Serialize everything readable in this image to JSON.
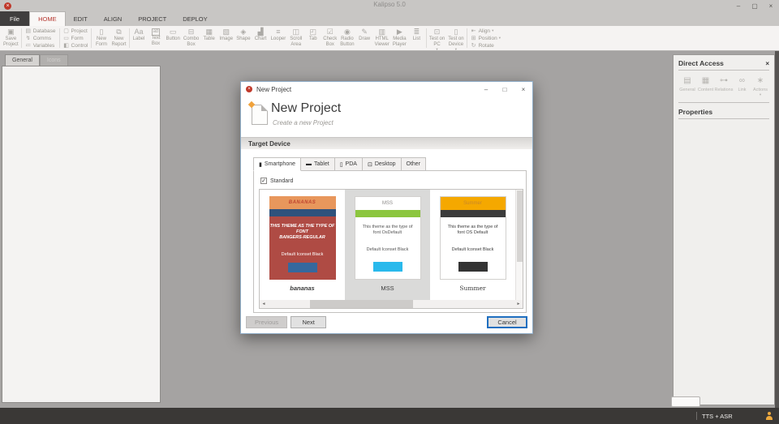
{
  "window": {
    "title": "Kalipso 5.0",
    "controls": {
      "min": "–",
      "restore": "▢",
      "close": "×"
    }
  },
  "ribbon": {
    "tabs": [
      {
        "label": "File",
        "variant": "file"
      },
      {
        "label": "HOME",
        "variant": "active"
      },
      {
        "label": "EDIT"
      },
      {
        "label": "ALIGN"
      },
      {
        "label": "PROJECT"
      },
      {
        "label": "DEPLOY"
      }
    ],
    "groups": [
      {
        "type": "large",
        "items": [
          {
            "lines": [
              "Save",
              "Project"
            ],
            "icon": "save",
            "glyph": "▣"
          }
        ]
      },
      {
        "type": "stack",
        "items": [
          {
            "label": "Database",
            "icon": "database",
            "glyph": "▤"
          },
          {
            "label": "Comms",
            "icon": "comms",
            "glyph": "↯"
          },
          {
            "label": "Variables",
            "icon": "variables",
            "glyph": "≔"
          }
        ]
      },
      {
        "type": "stack",
        "items": [
          {
            "label": "Project",
            "icon": "project",
            "glyph": "▢"
          },
          {
            "label": "Form",
            "icon": "form",
            "glyph": "▭"
          },
          {
            "label": "Control",
            "icon": "control",
            "glyph": "◧"
          }
        ]
      },
      {
        "type": "large",
        "items": [
          {
            "lines": [
              "New",
              "Form"
            ],
            "icon": "new-form",
            "glyph": "▯"
          },
          {
            "lines": [
              "New",
              "Report"
            ],
            "icon": "new-report",
            "glyph": "⧉"
          }
        ]
      },
      {
        "type": "large",
        "items": [
          {
            "lines": [
              "Label"
            ],
            "icon": "label",
            "glyph": "Aa"
          },
          {
            "lines": [
              "Text",
              "Box"
            ],
            "icon": "text-box",
            "glyph": "ab",
            "boxed": true
          },
          {
            "lines": [
              "Button"
            ],
            "icon": "button",
            "glyph": "▭"
          },
          {
            "lines": [
              "Combo",
              "Box"
            ],
            "icon": "combo-box",
            "glyph": "⊟"
          },
          {
            "lines": [
              "Table"
            ],
            "icon": "table",
            "glyph": "▦"
          },
          {
            "lines": [
              "Image"
            ],
            "icon": "image",
            "glyph": "▧"
          },
          {
            "lines": [
              "Shape"
            ],
            "icon": "shape",
            "glyph": "◈"
          },
          {
            "lines": [
              "Chart"
            ],
            "icon": "chart",
            "glyph": "▟"
          },
          {
            "lines": [
              "Looper"
            ],
            "icon": "looper",
            "glyph": "≡"
          },
          {
            "lines": [
              "Scroll",
              "Area"
            ],
            "icon": "scroll-area",
            "glyph": "◫"
          },
          {
            "lines": [
              "Tab"
            ],
            "icon": "tab",
            "glyph": "◰"
          },
          {
            "lines": [
              "Check",
              "Box"
            ],
            "icon": "check-box",
            "glyph": "☑"
          },
          {
            "lines": [
              "Radio",
              "Button"
            ],
            "icon": "radio-button",
            "glyph": "◉"
          },
          {
            "lines": [
              "Draw"
            ],
            "icon": "draw",
            "glyph": "✎"
          },
          {
            "lines": [
              "HTML",
              "Viewer"
            ],
            "icon": "html-viewer",
            "glyph": "▥"
          },
          {
            "lines": [
              "Media",
              "Player"
            ],
            "icon": "media-player",
            "glyph": "▶"
          },
          {
            "lines": [
              "List"
            ],
            "icon": "list",
            "glyph": "≣"
          }
        ]
      },
      {
        "type": "large",
        "items": [
          {
            "lines": [
              "Test on",
              "PC"
            ],
            "icon": "test-on-pc",
            "glyph": "⊡",
            "caret": true
          },
          {
            "lines": [
              "Test on",
              "Device"
            ],
            "icon": "test-on-device",
            "glyph": "▯",
            "caret": true
          }
        ]
      },
      {
        "type": "stack",
        "items": [
          {
            "label": "Align",
            "icon": "align",
            "glyph": "⇤",
            "caret": true
          },
          {
            "label": "Position",
            "icon": "position",
            "glyph": "⊞",
            "caret": true
          },
          {
            "label": "Rotate",
            "icon": "rotate",
            "glyph": "↻"
          }
        ]
      }
    ]
  },
  "left_panel": {
    "tabs": [
      {
        "label": "General",
        "selected": true
      },
      {
        "label": "Icons",
        "selected": false
      }
    ]
  },
  "right_panel": {
    "title": "Direct Access",
    "close": "×",
    "items": [
      {
        "label": "General",
        "icon": "general",
        "glyph": "▤"
      },
      {
        "label": "Content",
        "icon": "content",
        "glyph": "▦"
      },
      {
        "label": "Relations",
        "icon": "relations",
        "glyph": "⊶"
      },
      {
        "label": "Link",
        "icon": "link",
        "glyph": "∞"
      },
      {
        "label": "Actions",
        "icon": "actions",
        "glyph": "∗",
        "caret": true
      }
    ],
    "properties_title": "Properties"
  },
  "status_bar": {
    "text": "TTS + ASR"
  },
  "dialog": {
    "title": "New Project",
    "controls": {
      "min": "–",
      "max": "□",
      "close": "×"
    },
    "heading": "New Project",
    "subheading": "Create a new Project",
    "section_title": "Target Device",
    "tabs": [
      {
        "label": "Smartphone",
        "icon": "smartphone",
        "glyph": "▮",
        "selected": true
      },
      {
        "label": "Tablet",
        "icon": "tablet",
        "glyph": "▬"
      },
      {
        "label": "PDA",
        "icon": "pda",
        "glyph": "▯"
      },
      {
        "label": "Desktop",
        "icon": "desktop",
        "glyph": "⊡"
      },
      {
        "label": "Other"
      }
    ],
    "standard_checkbox": {
      "label": "Standard",
      "checked": true,
      "check": "✓"
    },
    "themes": [
      {
        "name": "bananas",
        "header": "BANANAS",
        "desc_lines": [
          "THIS THEME AS THE TYPE OF FONT",
          "BANGERS-REGULAR"
        ],
        "iconset": "Default Iconset Black",
        "selected": false,
        "style": "loud",
        "colors": {
          "header_bg": "#e8975c",
          "header_text": "#bf4430",
          "band": "#2f527c",
          "body_bg": "#af4b44",
          "body_text": "#ffffff",
          "button": "#36689d"
        }
      },
      {
        "name": "MSS",
        "header": "MSS",
        "desc_lines": [
          "This theme as the type of",
          "font OsDefault"
        ],
        "iconset": "Default Iconset Black",
        "selected": true,
        "style": "plain",
        "colors": {
          "header_bg": "#ffffff",
          "header_text": "#8a8886",
          "band": "#8cc63e",
          "body_bg": "#ffffff",
          "body_text": "#555555",
          "button": "#29b9ec"
        }
      },
      {
        "name": "Summer",
        "header": "Summer",
        "desc_lines": [
          "This theme as the type of",
          "font OS Default"
        ],
        "iconset": "Default Iconset Black",
        "selected": false,
        "style": "serif",
        "colors": {
          "header_bg": "#f5a800",
          "header_text": "#c8872b",
          "band": "#3b3b3b",
          "body_bg": "#ffffff",
          "body_text": "#3b3b3b",
          "button": "#333333"
        }
      }
    ],
    "scroll": {
      "left": "◄",
      "right": "►"
    },
    "buttons": [
      {
        "label": "Previous",
        "state": "disabled"
      },
      {
        "label": "Next",
        "state": "normal"
      },
      {
        "label": "Cancel",
        "state": "default"
      }
    ]
  }
}
